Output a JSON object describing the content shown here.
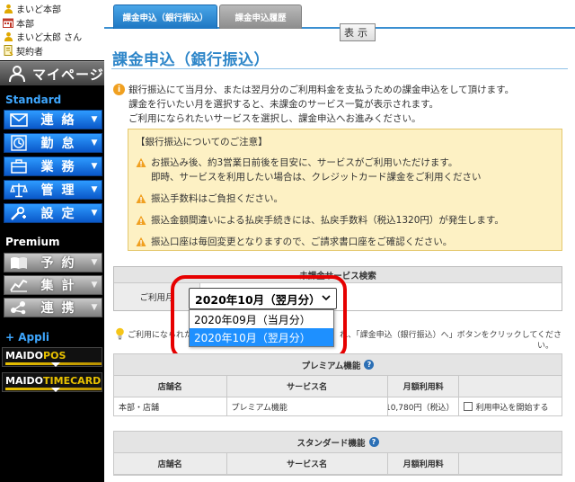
{
  "sidebar": {
    "user_lines": [
      {
        "icon": "user-icon",
        "text": "まいど本部"
      },
      {
        "icon": "store-icon",
        "text": "本部"
      },
      {
        "icon": "user-icon",
        "text": "まいど太郎 さん"
      },
      {
        "icon": "contract-icon",
        "text": "契約者"
      }
    ],
    "mypage_label": "マイページ",
    "standard_label": "Standard",
    "standard_menu": [
      {
        "label": "連絡",
        "icon": "mail-icon"
      },
      {
        "label": "勤怠",
        "icon": "clock-icon"
      },
      {
        "label": "業務",
        "icon": "briefcase-icon"
      },
      {
        "label": "管理",
        "icon": "scale-icon"
      },
      {
        "label": "設定",
        "icon": "tools-icon"
      }
    ],
    "premium_label": "Premium",
    "premium_menu": [
      {
        "label": "予約",
        "icon": "book-icon"
      },
      {
        "label": "集計",
        "icon": "chart-icon"
      },
      {
        "label": "連携",
        "icon": "network-icon"
      }
    ],
    "appli_label": "+ Appli",
    "apps": [
      {
        "main": "MAIDO",
        "accent": "POS"
      },
      {
        "main": "MAIDO",
        "accent": "TIMECARD"
      }
    ]
  },
  "tabs": {
    "active": "課金申込（銀行振込）",
    "history": "課金申込履歴"
  },
  "page": {
    "title": "課金申込（銀行振込）",
    "intro_lines": [
      "銀行振込にて当月分、または翌月分のご利用料金を支払うための課金申込をして頂けます。",
      "課金を行いたい月を選択すると、未課金のサービス一覧が表示されます。",
      "ご利用になられたいサービスを選択し、課金申込へお進みください。"
    ],
    "notice": {
      "title": "【銀行振込についてのご注意】",
      "items": [
        [
          "お振込み後、約3営業日前後を目安に、サービスがご利用いただけます。",
          "即時、サービスを利用したい場合は、クレジットカード課金をご利用ください"
        ],
        [
          "振込手数料はご負担ください。"
        ],
        [
          "振込金額間違いによる払戻手続きには、払戻手数料（税込1320円）が発生します。"
        ],
        [
          "振込口座は毎回変更となりますので、ご請求書口座をご確認ください。"
        ]
      ]
    }
  },
  "search": {
    "header": "未課金サービス検索",
    "label": "ご利用月",
    "selected": "2020年10月（翌月分）",
    "options": [
      "2020年09月（当月分）",
      "2020年10月（翌月分）"
    ],
    "selected_index": 1,
    "button_label": "表示"
  },
  "hint": {
    "before": "ご利用になられた",
    "after": "れ、「課金申込（銀行振込）へ」ボタンをクリックしてくださ",
    "trail": "い。"
  },
  "premium_table": {
    "title": "プレミアム機能",
    "columns": [
      "店舗名",
      "サービス名",
      "月額利用料",
      ""
    ],
    "rows": [
      {
        "store": "本部・店舗",
        "service": "プレミアム機能",
        "price": "10,780円（税込）",
        "action": "利用申込を開始する"
      }
    ]
  },
  "standard_table": {
    "title": "スタンダード機能",
    "columns": [
      "店舗名",
      "サービス名",
      "月額利用料",
      ""
    ],
    "rows": [
      {
        "store": "",
        "service": "",
        "price": "",
        "action": ""
      }
    ]
  },
  "colors": {
    "accent": "#2e86c9",
    "tab_active": "#1d76c2",
    "notice_bg": "#fdf1c4",
    "highlight": "#e60000",
    "dropdown_selected": "#1e90ff"
  }
}
